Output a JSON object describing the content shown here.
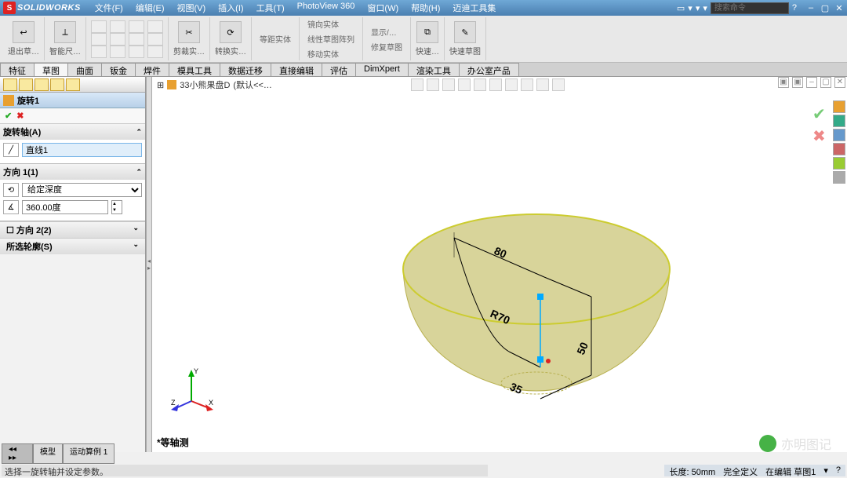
{
  "app": {
    "name": "SOLIDWORKS",
    "logo_letter": "S"
  },
  "menus": [
    "文件(F)",
    "编辑(E)",
    "视图(V)",
    "插入(I)",
    "工具(T)",
    "PhotoView 360",
    "窗口(W)",
    "帮助(H)",
    "迈迪工具集"
  ],
  "search_placeholder": "搜索命令",
  "ribbon": {
    "g1": "退出草…",
    "g2": "智能尺…",
    "g3": "剪裁实…",
    "g4": "转换实…",
    "g5a": "等距实体",
    "g5b": "镜向实体",
    "g5c": "线性草图阵列",
    "g5d": "移动实体",
    "g6a": "显示/…",
    "g6b": "修复草图",
    "g7": "快速…",
    "g8a": "快速草图"
  },
  "command_tabs": [
    "特征",
    "草图",
    "曲面",
    "钣金",
    "焊件",
    "模具工具",
    "数据迁移",
    "直接编辑",
    "评估",
    "DimXpert",
    "渲染工具",
    "办公室产品"
  ],
  "feature": {
    "title": "旋转1",
    "sec_axis": "旋转轴(A)",
    "axis_value": "直线1",
    "sec_dir1": "方向 1(1)",
    "dir1_type": "给定深度",
    "dir1_angle": "360.00度",
    "sec_dir2": "方向 2(2)",
    "sec_contour": "所选轮廓(S)"
  },
  "document": {
    "name": "33小熊果盘D",
    "state": "(默认<<…"
  },
  "sketch_dims": {
    "d1": "80",
    "d2": "R70",
    "d3": "35",
    "d4": "50"
  },
  "view_name": "*等轴测",
  "triad": {
    "x": "X",
    "y": "Y",
    "z": "Z"
  },
  "bottom_tabs": [
    "模型",
    "运动算例 1"
  ],
  "status": {
    "hint": "选择一旋转轴并设定参数。",
    "length": "长度: 50mm",
    "def": "完全定义",
    "ctx": "在编辑 草图1"
  },
  "watermark": "亦明图记",
  "colors": {
    "model_fill": "#d8d49a",
    "model_edge": "#b8b050"
  }
}
